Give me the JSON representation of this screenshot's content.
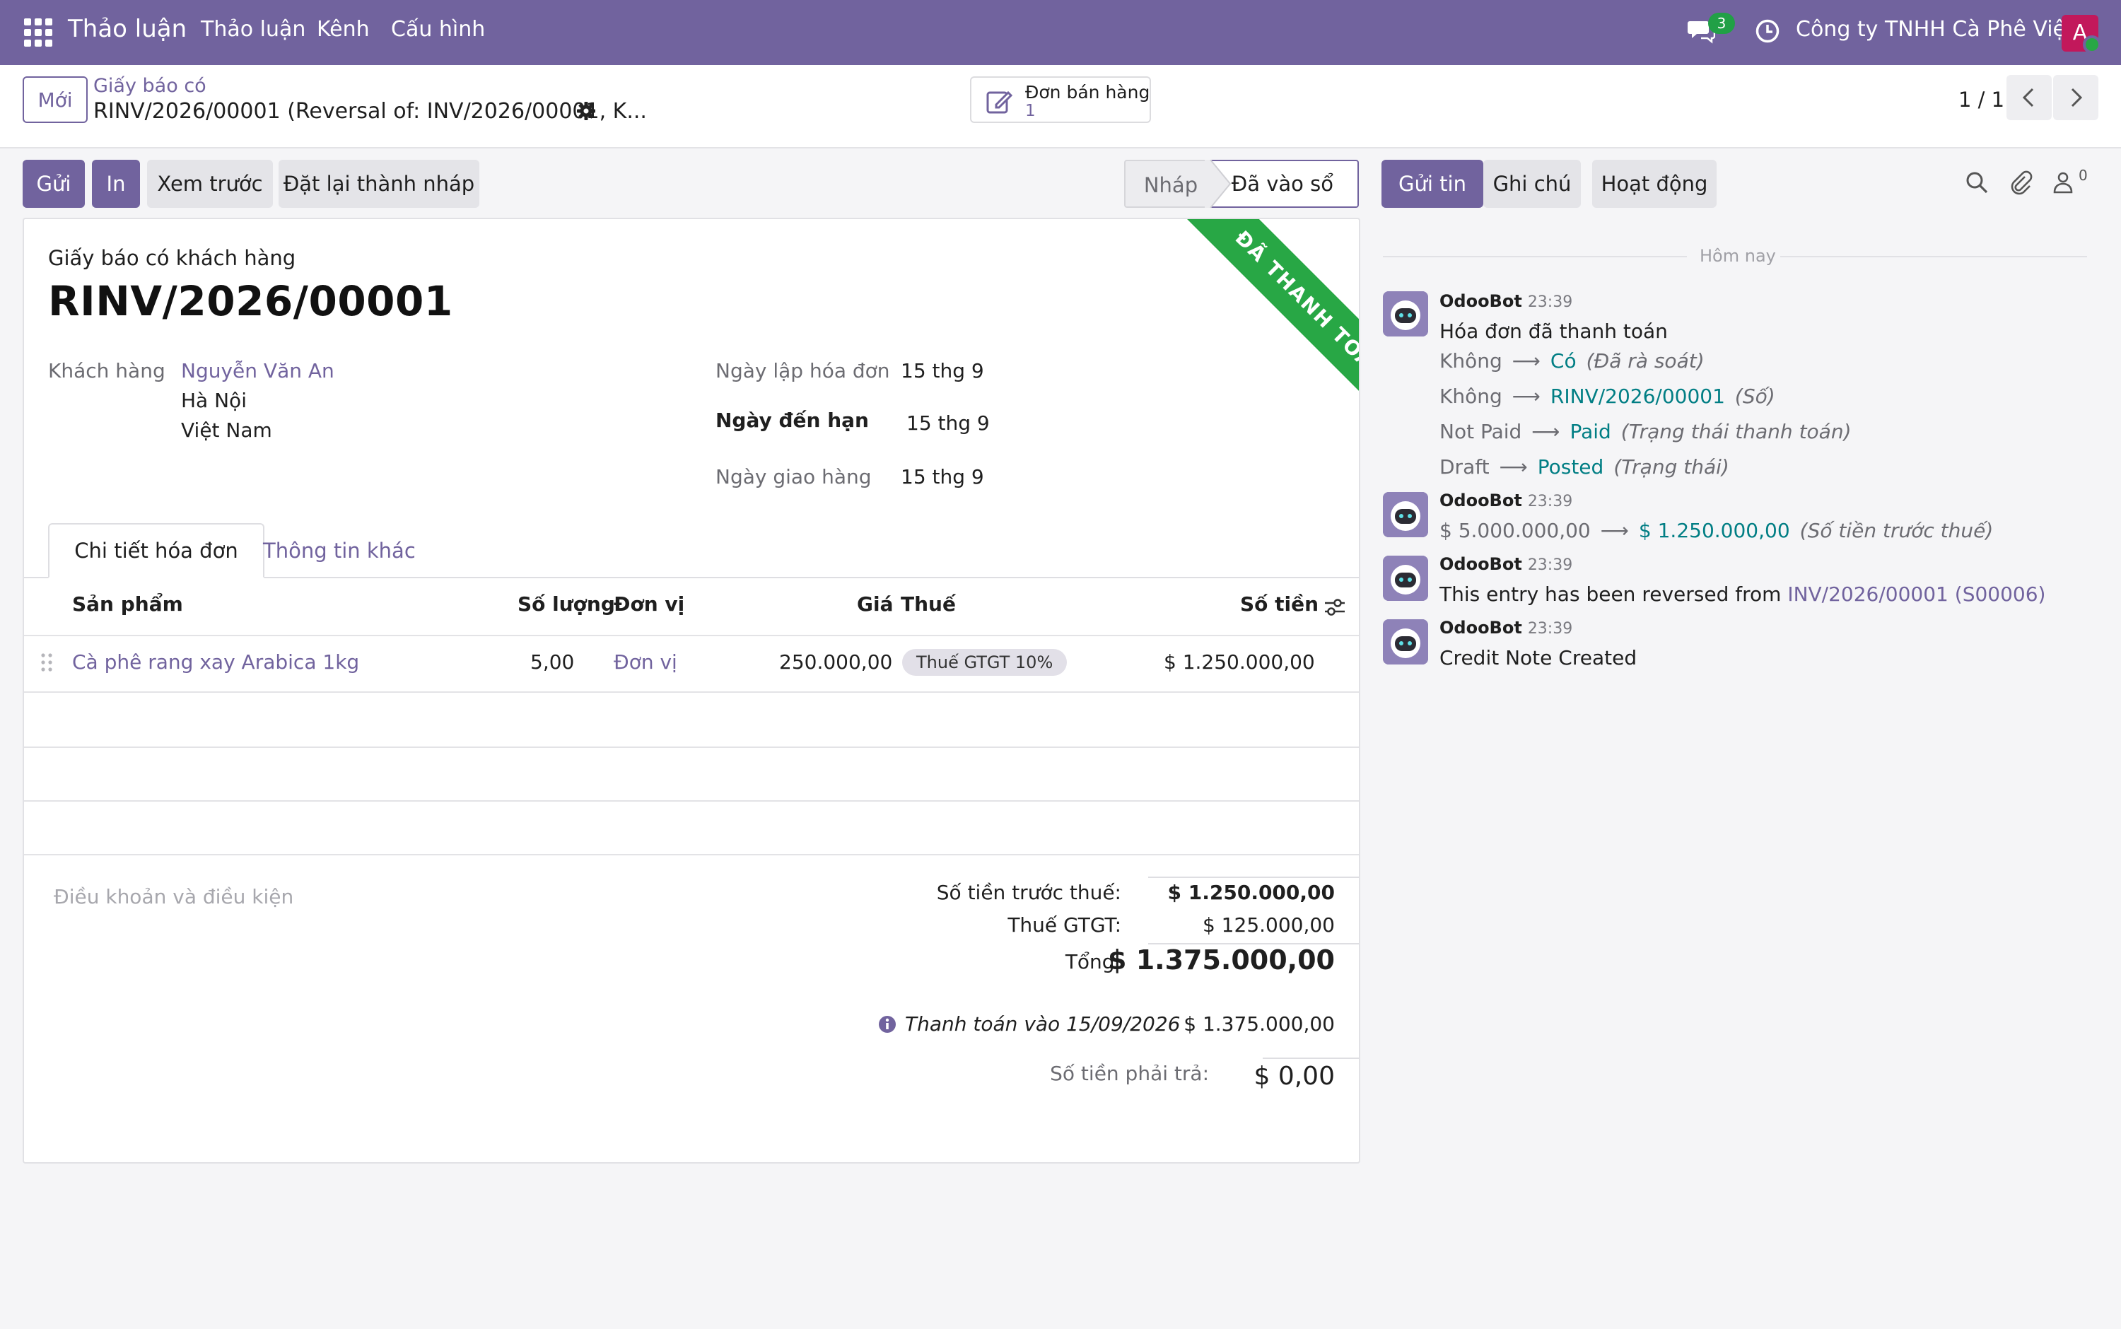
{
  "navbar": {
    "brand": "Thảo luận",
    "menu": [
      "Thảo luận",
      "Kênh",
      "Cấu hình"
    ],
    "messages_count": "3",
    "company": "Công ty TNHH Cà Phê Việt",
    "user_initial": "A",
    "accent": "#71639e"
  },
  "control": {
    "new_label": "Mới",
    "breadcrumb_parent": "Giấy báo có",
    "breadcrumb_current": "RINV/2026/00001 (Reversal of: INV/2026/00001, K...",
    "smart_button": {
      "label": "Đơn bán hàng",
      "count": "1"
    },
    "pager": "1 / 1"
  },
  "actions": {
    "send": "Gửi",
    "print": "In",
    "preview": "Xem trước",
    "reset_draft": "Đặt lại thành nháp"
  },
  "status": {
    "draft": "Nháp",
    "posted": "Đã vào sổ"
  },
  "form": {
    "ribbon": "ĐÃ THANH TOÁN",
    "ribbon_color": "#28a745",
    "doc_type": "Giấy báo có khách hàng",
    "number": "RINV/2026/00001",
    "customer_label": "Khách hàng",
    "customer_name": "Nguyễn Văn An",
    "customer_city": "Hà Nội",
    "customer_country": "Việt Nam",
    "invoice_date_label": "Ngày lập hóa đơn",
    "invoice_date": "15 thg 9",
    "due_date_label": "Ngày đến hạn",
    "due_date": "15 thg 9",
    "delivery_date_label": "Ngày giao hàng",
    "delivery_date": "15 thg 9",
    "tabs": [
      "Chi tiết hóa đơn",
      "Thông tin khác"
    ],
    "columns": {
      "product": "Sản phẩm",
      "qty": "Số lượng",
      "uom": "Đơn vị",
      "price": "Giá",
      "tax": "Thuế",
      "amount": "Số tiền"
    },
    "lines": [
      {
        "product": "Cà phê rang xay Arabica 1kg",
        "qty": "5,00",
        "uom": "Đơn vị",
        "price": "250.000,00",
        "tax": "Thuế GTGT 10%",
        "amount": "$ 1.250.000,00"
      }
    ],
    "terms_placeholder": "Điều khoản và điều kiện",
    "totals": {
      "untaxed_label": "Số tiền trước thuế:",
      "untaxed": "$ 1.250.000,00",
      "vat_label": "Thuế GTGT:",
      "vat": "$ 125.000,00",
      "total_label": "Tổng:",
      "total": "$ 1.375.000,00",
      "payment_label": "Thanh toán vào 15/09/2026",
      "payment": "$ 1.375.000,00",
      "due_label": "Số tiền phải trả:",
      "due": "$ 0,00"
    }
  },
  "chatter": {
    "send_message": "Gửi tin",
    "log_note": "Ghi chú",
    "activities": "Hoạt động",
    "followers": "0",
    "today": "Hôm nay",
    "messages": [
      {
        "author": "OdooBot",
        "time": "23:39",
        "text": "Hóa đơn đã thanh toán",
        "tracking": [
          {
            "old": "Không",
            "new": "Có",
            "field": "(Đã rà soát)"
          },
          {
            "old": "Không",
            "new": "RINV/2026/00001",
            "field": "(Số)"
          },
          {
            "old": "Not Paid",
            "new": "Paid",
            "field": "(Trạng thái thanh toán)"
          },
          {
            "old": "Draft",
            "new": "Posted",
            "field": "(Trạng thái)"
          }
        ]
      },
      {
        "author": "OdooBot",
        "time": "23:39",
        "tracking": [
          {
            "old": "$ 5.000.000,00",
            "new": "$ 1.250.000,00",
            "field": "(Số tiền trước thuế)"
          }
        ]
      },
      {
        "author": "OdooBot",
        "time": "23:39",
        "text_prefix": "This entry has been reversed from",
        "text_link": "INV/2026/00001 (S00006)"
      },
      {
        "author": "OdooBot",
        "time": "23:39",
        "text": "Credit Note Created"
      }
    ]
  }
}
